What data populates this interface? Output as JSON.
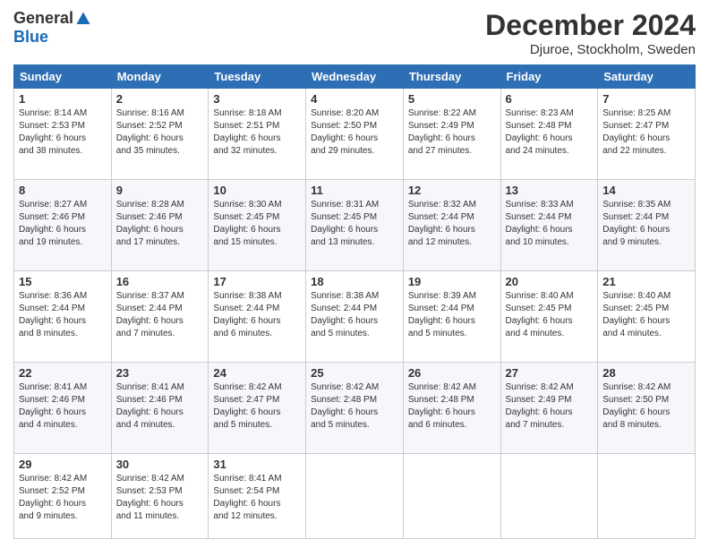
{
  "header": {
    "logo": {
      "general": "General",
      "blue": "Blue"
    },
    "title": "December 2024",
    "location": "Djuroe, Stockholm, Sweden"
  },
  "columns": [
    "Sunday",
    "Monday",
    "Tuesday",
    "Wednesday",
    "Thursday",
    "Friday",
    "Saturday"
  ],
  "weeks": [
    [
      {
        "day": "1",
        "text": "Sunrise: 8:14 AM\nSunset: 2:53 PM\nDaylight: 6 hours\nand 38 minutes."
      },
      {
        "day": "2",
        "text": "Sunrise: 8:16 AM\nSunset: 2:52 PM\nDaylight: 6 hours\nand 35 minutes."
      },
      {
        "day": "3",
        "text": "Sunrise: 8:18 AM\nSunset: 2:51 PM\nDaylight: 6 hours\nand 32 minutes."
      },
      {
        "day": "4",
        "text": "Sunrise: 8:20 AM\nSunset: 2:50 PM\nDaylight: 6 hours\nand 29 minutes."
      },
      {
        "day": "5",
        "text": "Sunrise: 8:22 AM\nSunset: 2:49 PM\nDaylight: 6 hours\nand 27 minutes."
      },
      {
        "day": "6",
        "text": "Sunrise: 8:23 AM\nSunset: 2:48 PM\nDaylight: 6 hours\nand 24 minutes."
      },
      {
        "day": "7",
        "text": "Sunrise: 8:25 AM\nSunset: 2:47 PM\nDaylight: 6 hours\nand 22 minutes."
      }
    ],
    [
      {
        "day": "8",
        "text": "Sunrise: 8:27 AM\nSunset: 2:46 PM\nDaylight: 6 hours\nand 19 minutes."
      },
      {
        "day": "9",
        "text": "Sunrise: 8:28 AM\nSunset: 2:46 PM\nDaylight: 6 hours\nand 17 minutes."
      },
      {
        "day": "10",
        "text": "Sunrise: 8:30 AM\nSunset: 2:45 PM\nDaylight: 6 hours\nand 15 minutes."
      },
      {
        "day": "11",
        "text": "Sunrise: 8:31 AM\nSunset: 2:45 PM\nDaylight: 6 hours\nand 13 minutes."
      },
      {
        "day": "12",
        "text": "Sunrise: 8:32 AM\nSunset: 2:44 PM\nDaylight: 6 hours\nand 12 minutes."
      },
      {
        "day": "13",
        "text": "Sunrise: 8:33 AM\nSunset: 2:44 PM\nDaylight: 6 hours\nand 10 minutes."
      },
      {
        "day": "14",
        "text": "Sunrise: 8:35 AM\nSunset: 2:44 PM\nDaylight: 6 hours\nand 9 minutes."
      }
    ],
    [
      {
        "day": "15",
        "text": "Sunrise: 8:36 AM\nSunset: 2:44 PM\nDaylight: 6 hours\nand 8 minutes."
      },
      {
        "day": "16",
        "text": "Sunrise: 8:37 AM\nSunset: 2:44 PM\nDaylight: 6 hours\nand 7 minutes."
      },
      {
        "day": "17",
        "text": "Sunrise: 8:38 AM\nSunset: 2:44 PM\nDaylight: 6 hours\nand 6 minutes."
      },
      {
        "day": "18",
        "text": "Sunrise: 8:38 AM\nSunset: 2:44 PM\nDaylight: 6 hours\nand 5 minutes."
      },
      {
        "day": "19",
        "text": "Sunrise: 8:39 AM\nSunset: 2:44 PM\nDaylight: 6 hours\nand 5 minutes."
      },
      {
        "day": "20",
        "text": "Sunrise: 8:40 AM\nSunset: 2:45 PM\nDaylight: 6 hours\nand 4 minutes."
      },
      {
        "day": "21",
        "text": "Sunrise: 8:40 AM\nSunset: 2:45 PM\nDaylight: 6 hours\nand 4 minutes."
      }
    ],
    [
      {
        "day": "22",
        "text": "Sunrise: 8:41 AM\nSunset: 2:46 PM\nDaylight: 6 hours\nand 4 minutes."
      },
      {
        "day": "23",
        "text": "Sunrise: 8:41 AM\nSunset: 2:46 PM\nDaylight: 6 hours\nand 4 minutes."
      },
      {
        "day": "24",
        "text": "Sunrise: 8:42 AM\nSunset: 2:47 PM\nDaylight: 6 hours\nand 5 minutes."
      },
      {
        "day": "25",
        "text": "Sunrise: 8:42 AM\nSunset: 2:48 PM\nDaylight: 6 hours\nand 5 minutes."
      },
      {
        "day": "26",
        "text": "Sunrise: 8:42 AM\nSunset: 2:48 PM\nDaylight: 6 hours\nand 6 minutes."
      },
      {
        "day": "27",
        "text": "Sunrise: 8:42 AM\nSunset: 2:49 PM\nDaylight: 6 hours\nand 7 minutes."
      },
      {
        "day": "28",
        "text": "Sunrise: 8:42 AM\nSunset: 2:50 PM\nDaylight: 6 hours\nand 8 minutes."
      }
    ],
    [
      {
        "day": "29",
        "text": "Sunrise: 8:42 AM\nSunset: 2:52 PM\nDaylight: 6 hours\nand 9 minutes."
      },
      {
        "day": "30",
        "text": "Sunrise: 8:42 AM\nSunset: 2:53 PM\nDaylight: 6 hours\nand 11 minutes."
      },
      {
        "day": "31",
        "text": "Sunrise: 8:41 AM\nSunset: 2:54 PM\nDaylight: 6 hours\nand 12 minutes."
      },
      null,
      null,
      null,
      null
    ]
  ]
}
